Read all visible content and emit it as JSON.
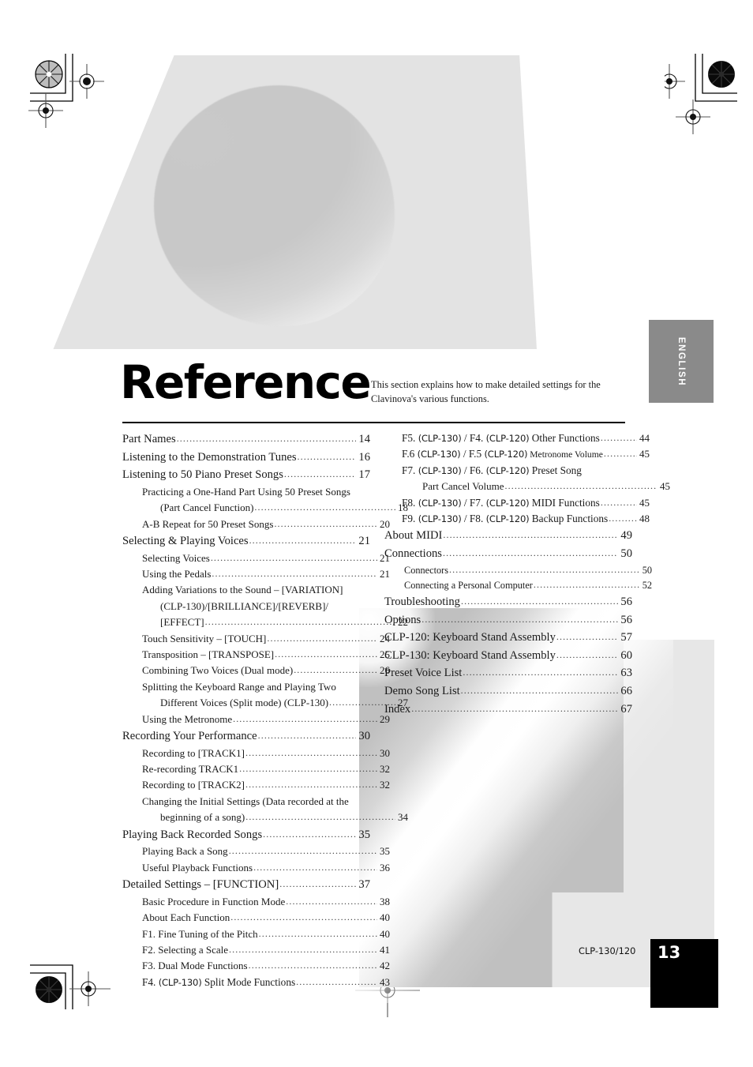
{
  "page": {
    "heading": "Reference",
    "intro": "This section explains how to make detailed settings for the Clavinova's various functions.",
    "side_tab": "ENGLISH",
    "footer_model": "CLP-130/120",
    "page_number": "13",
    "accent_colors": {
      "tab_gray": "#8a8a8a",
      "art_light_gray": "#e3e3e3",
      "art_mid_gray": "#c0c0c0",
      "page_box_black": "#000000",
      "rule_black": "#000000"
    }
  },
  "toc": {
    "left_column": [
      {
        "level": 1,
        "label": "Part Names",
        "page": "14"
      },
      {
        "level": 1,
        "label": "Listening to the Demonstration Tunes",
        "page": "16"
      },
      {
        "level": 1,
        "label": "Listening to 50 Piano Preset Songs",
        "page": "17"
      },
      {
        "level": 2,
        "label": "Practicing a One-Hand Part Using 50 Preset Songs",
        "page": "",
        "wrap": true
      },
      {
        "level": 3,
        "label": "(Part Cancel Function)",
        "page": "18"
      },
      {
        "level": 2,
        "label": "A-B Repeat for 50 Preset Songs",
        "page": "20"
      },
      {
        "level": 1,
        "label": "Selecting & Playing Voices",
        "page": "21"
      },
      {
        "level": 2,
        "label": "Selecting Voices",
        "page": "21"
      },
      {
        "level": 2,
        "label": "Using the Pedals",
        "page": "21"
      },
      {
        "level": 2,
        "label": "Adding Variations to the Sound – [VARIATION]",
        "page": "",
        "wrap": true
      },
      {
        "level": 3,
        "label": "(CLP-130)/[BRILLIANCE]/[REVERB]/",
        "page": "",
        "wrap": true
      },
      {
        "level": 3,
        "label": "[EFFECT]",
        "page": "22"
      },
      {
        "level": 2,
        "label": "Touch Sensitivity – [TOUCH]",
        "page": "24"
      },
      {
        "level": 2,
        "label": "Transposition – [TRANSPOSE]",
        "page": "25"
      },
      {
        "level": 2,
        "label": "Combining Two Voices (Dual mode)",
        "page": "26"
      },
      {
        "level": 2,
        "label": "Splitting the Keyboard Range and Playing Two",
        "page": "",
        "wrap": true
      },
      {
        "level": 3,
        "label": "Different Voices (Split mode) (CLP-130)",
        "page": "27"
      },
      {
        "level": 2,
        "label": "Using the Metronome",
        "page": "29"
      },
      {
        "level": 1,
        "label": "Recording Your Performance",
        "page": "30"
      },
      {
        "level": 2,
        "label": "Recording to [TRACK1]",
        "page": "30"
      },
      {
        "level": 2,
        "label": "Re-recording TRACK1",
        "page": "32"
      },
      {
        "level": 2,
        "label": "Recording to [TRACK2]",
        "page": "32"
      },
      {
        "level": 2,
        "label": "Changing the Initial Settings (Data recorded at the",
        "page": "",
        "wrap": true
      },
      {
        "level": 3,
        "label": "beginning of a song)",
        "page": "34"
      },
      {
        "level": 1,
        "label": "Playing Back Recorded Songs",
        "page": "35"
      },
      {
        "level": 2,
        "label": "Playing Back a Song",
        "page": "35"
      },
      {
        "level": 2,
        "label": "Useful Playback Functions",
        "page": "36"
      },
      {
        "level": 1,
        "label": "Detailed Settings – [FUNCTION]",
        "page": "37"
      },
      {
        "level": 2,
        "label": "Basic Procedure in Function Mode",
        "page": "38"
      },
      {
        "level": 2,
        "label": "About Each Function",
        "page": "40"
      },
      {
        "level": 2,
        "label": "F1. Fine Tuning of the Pitch",
        "page": "40"
      },
      {
        "level": 2,
        "label": "F2. Selecting a Scale",
        "page": "41"
      },
      {
        "level": 2,
        "label": "F3. Dual Mode Functions",
        "page": "42"
      },
      {
        "level": 2,
        "label": "F4. (CLP-130) Split Mode Functions",
        "page": "43",
        "parts": [
          "F4. ",
          "(CLP-130)",
          " Split Mode Functions"
        ]
      }
    ],
    "right_column": [
      {
        "level": "fn",
        "page": "44",
        "parts": [
          "F5. ",
          "(CLP-130)",
          " / F4. ",
          "(CLP-120)",
          " Other Functions"
        ]
      },
      {
        "level": "fn",
        "page": "45",
        "parts": [
          "F.6 ",
          "(CLP-130)",
          " / F.5 ",
          "(CLP-120)",
          " Metronome Volume"
        ],
        "small_tail": true
      },
      {
        "level": "fn",
        "page": "",
        "parts": [
          "F7. ",
          "(CLP-130)",
          " / F6. ",
          "(CLP-120)",
          " Preset Song"
        ],
        "wrap": true
      },
      {
        "level": "fn2",
        "label": "Part Cancel Volume",
        "page": "45"
      },
      {
        "level": "fn",
        "page": "45",
        "parts": [
          "F8. ",
          "(CLP-130)",
          " / F7. ",
          "(CLP-120)",
          " MIDI Functions"
        ]
      },
      {
        "level": "fn",
        "page": "48",
        "parts": [
          "F9. ",
          "(CLP-130)",
          " / F8. ",
          "(CLP-120)",
          " Backup Functions"
        ]
      },
      {
        "level": "sec",
        "label": "About MIDI",
        "page": "49"
      },
      {
        "level": "sec",
        "label": "Connections",
        "page": "50"
      },
      {
        "level": "sub",
        "label": "Connectors",
        "page": "50"
      },
      {
        "level": "sub",
        "label": "Connecting a Personal Computer",
        "page": "52"
      },
      {
        "level": "sec",
        "label": "Troubleshooting",
        "page": "56"
      },
      {
        "level": "sec",
        "label": "Options",
        "page": "56"
      },
      {
        "level": "sec",
        "label": "CLP-120: Keyboard Stand Assembly",
        "page": "57"
      },
      {
        "level": "sec",
        "label": "CLP-130: Keyboard Stand Assembly",
        "page": "60"
      },
      {
        "level": "sec",
        "label": "Preset Voice List",
        "page": "63"
      },
      {
        "level": "sec",
        "label": "Demo Song List",
        "page": "66"
      },
      {
        "level": "sec",
        "label": "Index",
        "page": "67"
      }
    ]
  }
}
